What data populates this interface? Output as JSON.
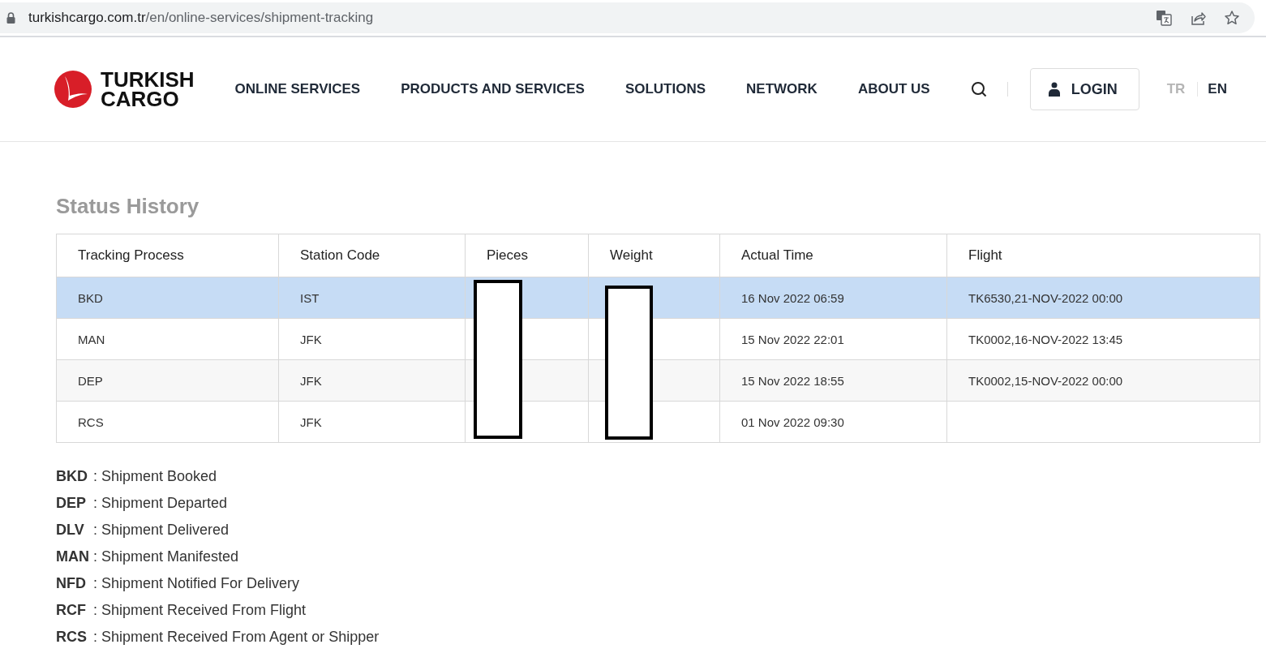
{
  "browser": {
    "url_host": "turkishcargo.com.tr",
    "url_path": "/en/online-services/shipment-tracking"
  },
  "header": {
    "logo_lines": [
      "TURKISH",
      "CARGO"
    ],
    "nav": [
      "ONLINE SERVICES",
      "PRODUCTS AND SERVICES",
      "SOLUTIONS",
      "NETWORK",
      "ABOUT US"
    ],
    "login": "LOGIN",
    "languages": [
      {
        "label": "TR",
        "selected": false
      },
      {
        "label": "EN",
        "selected": true
      }
    ]
  },
  "status_history": {
    "title": "Status History",
    "columns": [
      "Tracking Process",
      "Station Code",
      "Pieces",
      "Weight",
      "Actual Time",
      "Flight"
    ],
    "rows": [
      {
        "cells": [
          "BKD",
          "IST",
          "",
          "",
          "16 Nov 2022 06:59",
          "TK6530,21-NOV-2022 00:00"
        ],
        "selected": true
      },
      {
        "cells": [
          "MAN",
          "JFK",
          "",
          "",
          "15 Nov 2022 22:01",
          "TK0002,16-NOV-2022 13:45"
        ],
        "selected": false
      },
      {
        "cells": [
          "DEP",
          "JFK",
          "",
          "",
          "15 Nov 2022 18:55",
          "TK0002,15-NOV-2022 00:00"
        ],
        "selected": false
      },
      {
        "cells": [
          "RCS",
          "JFK",
          "",
          "",
          "01 Nov 2022 09:30",
          ""
        ],
        "selected": false
      }
    ]
  },
  "legend": [
    {
      "code": "BKD",
      "description": ": Shipment Booked"
    },
    {
      "code": "DEP",
      "description": ": Shipment Departed"
    },
    {
      "code": "DLV",
      "description": ": Shipment Delivered"
    },
    {
      "code": "MAN",
      "description": ": Shipment Manifested"
    },
    {
      "code": "NFD",
      "description": ": Shipment Notified For Delivery"
    },
    {
      "code": "RCF",
      "description": ": Shipment Received From Flight"
    },
    {
      "code": "RCS",
      "description": ": Shipment Received From Agent or Shipper"
    }
  ]
}
